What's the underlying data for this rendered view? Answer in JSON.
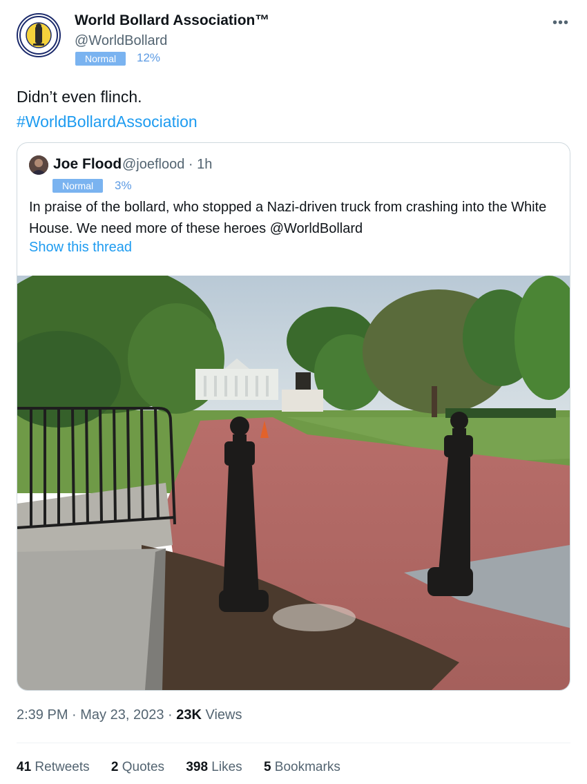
{
  "author": {
    "name": "World Bollard Association™",
    "handle": "@WorldBollard",
    "badge": "Normal",
    "percent": "12%"
  },
  "more_icon": "more-horizontal-icon",
  "tweet": {
    "text": "Didn’t even flinch.",
    "hashtag": "#WorldBollardAssociation"
  },
  "quote": {
    "name": "Joe Flood",
    "handle_time": "@joeflood · 1h",
    "badge": "Normal",
    "percent": "3%",
    "text": "In praise of the bollard, who stopped a Nazi-driven truck from crashing into the White House. We need more of these heroes @WorldBollard",
    "thread_link": "Show this thread"
  },
  "meta": {
    "time": "2:39 PM",
    "sep1": " · ",
    "date": "May 23, 2023",
    "sep2": " · ",
    "views_count": "23K",
    "views_label": " Views"
  },
  "stats": {
    "retweets_count": "41",
    "retweets_label": " Retweets",
    "quotes_count": "2",
    "quotes_label": " Quotes",
    "likes_count": "398",
    "likes_label": " Likes",
    "bookmarks_count": "5",
    "bookmarks_label": " Bookmarks"
  },
  "colors": {
    "link": "#1d9bf0",
    "badge": "#7ab3f0",
    "muted": "#536471"
  }
}
